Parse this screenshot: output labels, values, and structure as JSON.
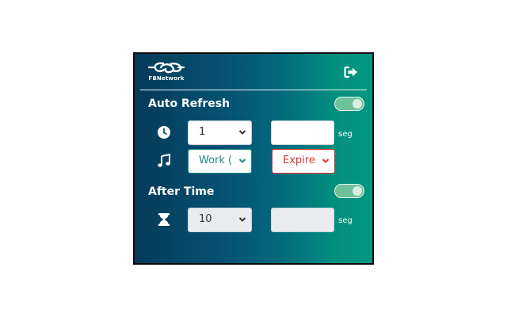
{
  "header": {
    "logo_text": "FBNetwork",
    "logout_icon": "sign-out-icon"
  },
  "auto_refresh": {
    "title": "Auto Refresh",
    "enabled": true,
    "interval_icon": "clock-icon",
    "interval_value": "1",
    "seconds_value": "",
    "seconds_unit": "seg",
    "sound_icon": "music-note-icon",
    "sound_value": "Work (",
    "alert_value": "Expire"
  },
  "after_time": {
    "title": "After Time",
    "enabled": true,
    "timer_icon": "hourglass-icon",
    "time_value": "10",
    "seconds_value": "",
    "seconds_unit": "seg"
  },
  "colors": {
    "gradient_start": "#063a59",
    "gradient_end": "#009882",
    "toggle_on": "#6fc19a",
    "teal_accent": "#1a8a7b",
    "red_accent": "#dd3333"
  }
}
